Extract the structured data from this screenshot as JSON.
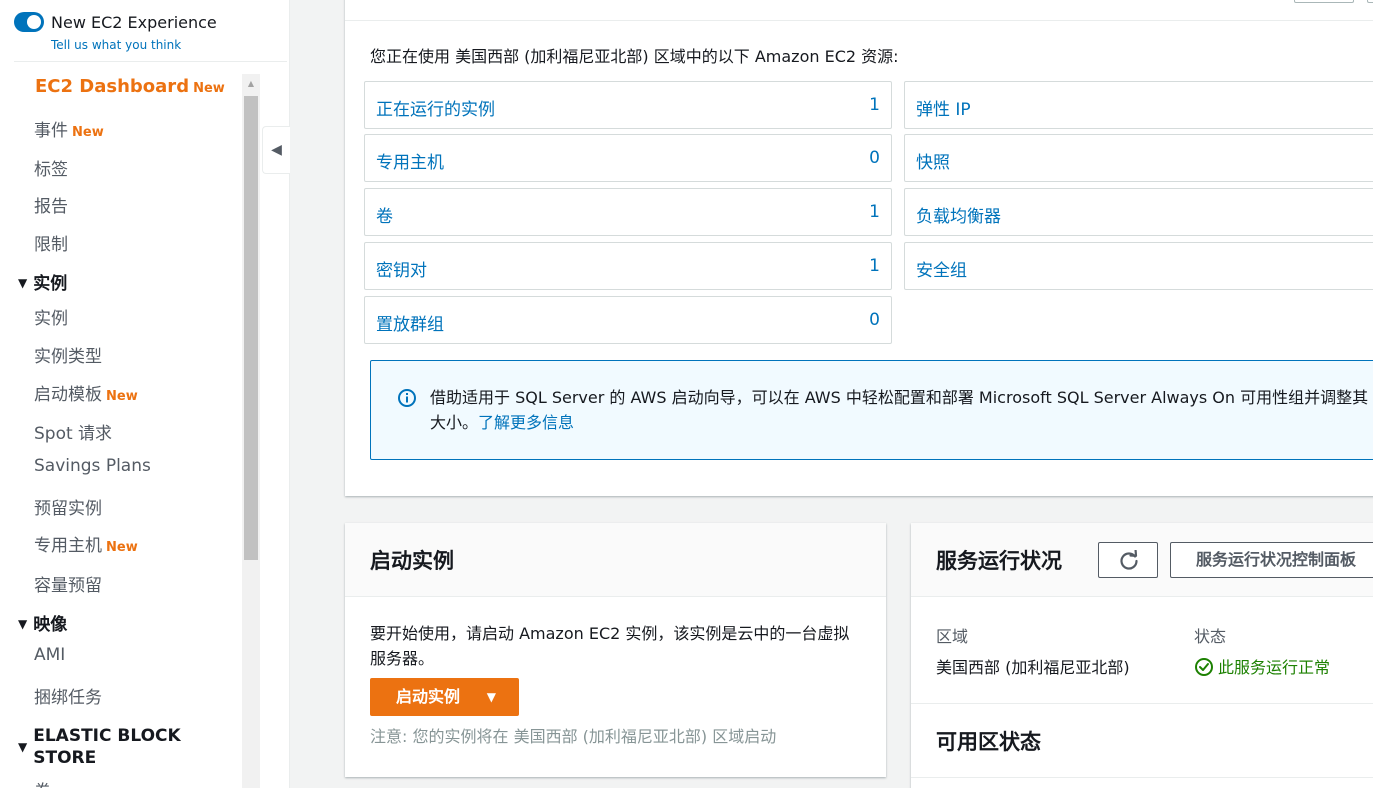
{
  "sidebar": {
    "new_experience": {
      "title": "New EC2 Experience",
      "link": "Tell us what you think",
      "toggle_on": true
    },
    "new_badge": "New",
    "items": [
      {
        "label": "EC2 Dashboard",
        "badge": "New",
        "active": true
      },
      {
        "label": "事件",
        "badge": "New"
      },
      {
        "label": "标签"
      },
      {
        "label": "报告"
      },
      {
        "label": "限制"
      }
    ],
    "sections": [
      {
        "label": "实例",
        "items": [
          {
            "label": "实例"
          },
          {
            "label": "实例类型"
          },
          {
            "label": "启动模板",
            "badge": "New"
          },
          {
            "label": "Spot 请求"
          },
          {
            "label": "Savings Plans"
          },
          {
            "label": "预留实例"
          },
          {
            "label": "专用主机",
            "badge": "New"
          },
          {
            "label": "容量预留"
          }
        ]
      },
      {
        "label": "映像",
        "items": [
          {
            "label": "AMI"
          },
          {
            "label": "捆绑任务"
          }
        ]
      },
      {
        "label_line1": "ELASTIC BLOCK",
        "label_line2": "STORE",
        "items": [
          {
            "label": "卷"
          }
        ]
      }
    ]
  },
  "resources": {
    "intro": "您正在使用 美国西部 (加利福尼亚北部) 区域中的以下 Amazon EC2 资源:",
    "left": [
      {
        "label": "正在运行的实例",
        "count": "1"
      },
      {
        "label": "专用主机",
        "count": "0"
      },
      {
        "label": "卷",
        "count": "1"
      },
      {
        "label": "密钥对",
        "count": "1"
      },
      {
        "label": "置放群组",
        "count": "0"
      }
    ],
    "right": [
      {
        "label": "弹性 IP"
      },
      {
        "label": "快照"
      },
      {
        "label": "负载均衡器"
      },
      {
        "label": "安全组"
      }
    ],
    "info": {
      "text": "借助适用于 SQL Server 的 AWS 启动向导，可以在 AWS 中轻松配置和部署 Microsoft SQL Server Always On 可用性组并调整其大小。",
      "link": "了解更多信息"
    }
  },
  "launch": {
    "title": "启动实例",
    "description": "要开始使用，请启动 Amazon EC2 实例，该实例是云中的一台虚拟服务器。",
    "button": "启动实例",
    "note": "注意: 您的实例将在 美国西部 (加利福尼亚北部) 区域启动"
  },
  "health": {
    "title": "服务运行状况",
    "dashboard_button": "服务运行状况控制面板",
    "region_label": "区域",
    "region_value": "美国西部 (加利福尼亚北部)",
    "status_label": "状态",
    "status_value": "此服务运行正常",
    "az_title": "可用区状态"
  },
  "colors": {
    "accent": "#ec7211",
    "link": "#0073bb",
    "success": "#1d8102"
  }
}
